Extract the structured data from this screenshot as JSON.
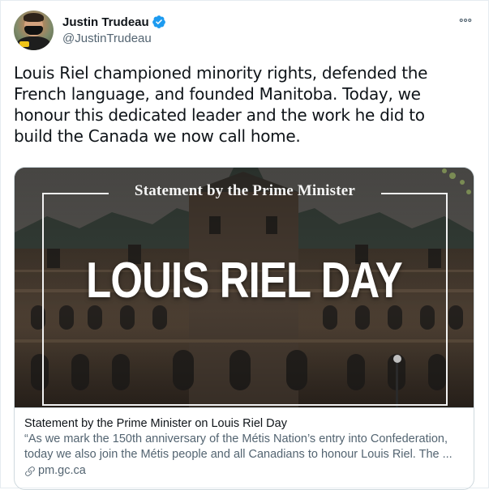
{
  "author": {
    "display_name": "Justin Trudeau",
    "handle": "@JustinTrudeau",
    "verified_icon": "verified-badge-icon",
    "avatar_icon": "avatar"
  },
  "more_icon": "more-options-icon",
  "tweet": {
    "lines": [
      "Louis Riel championed minority rights, defended the",
      "French language, and founded Manitoba. Today, we",
      "honour this dedicated leader and the work he did to",
      "build the Canada we now call home."
    ]
  },
  "card": {
    "image": {
      "heading": "Statement by the Prime Minister",
      "title": "LOUIS RIEL DAY"
    },
    "title": "Statement by the Prime Minister on Louis Riel Day",
    "description_lines": [
      "“As we mark the 150th anniversary of the Métis Nation’s entry into Confederation,",
      "today we also join the Métis people and all Canadians to honour Louis Riel. The ..."
    ],
    "domain": "pm.gc.ca",
    "domain_icon": "link-icon"
  },
  "colors": {
    "verified": "#1d9bf0",
    "secondary_text": "#536471",
    "border": "#cfd9de"
  }
}
